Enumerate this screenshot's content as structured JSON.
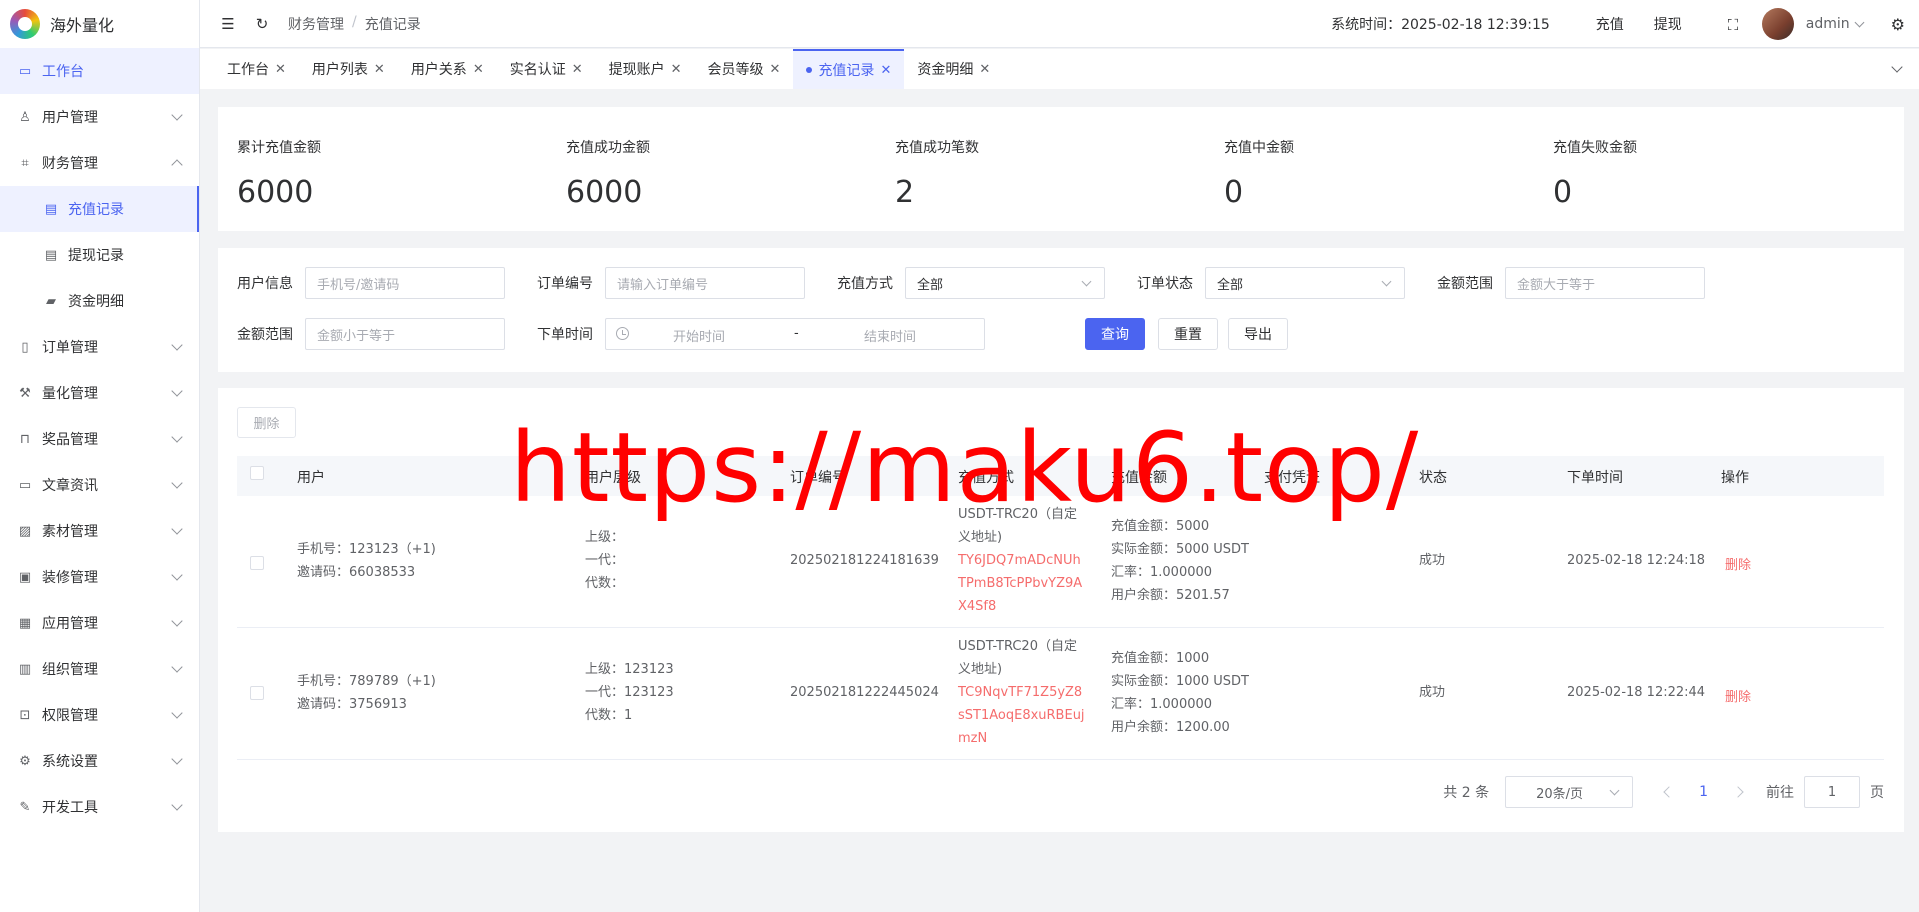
{
  "app": {
    "name": "海外量化"
  },
  "sidebar": {
    "items": [
      {
        "label": "工作台",
        "icon": "monitor-icon",
        "glyph": "▭"
      },
      {
        "label": "用户管理",
        "icon": "user-icon",
        "glyph": "♙"
      },
      {
        "label": "财务管理",
        "icon": "chart-icon",
        "glyph": "⌗"
      },
      {
        "label": "充值记录",
        "icon": "folder-icon",
        "glyph": "▤"
      },
      {
        "label": "提现记录",
        "icon": "folder-icon",
        "glyph": "▤"
      },
      {
        "label": "资金明细",
        "icon": "wallet-icon",
        "glyph": "▰"
      },
      {
        "label": "订单管理",
        "icon": "document-icon",
        "glyph": "▯"
      },
      {
        "label": "量化管理",
        "icon": "tool-icon",
        "glyph": "⚒"
      },
      {
        "label": "奖品管理",
        "icon": "bag-icon",
        "glyph": "⊓"
      },
      {
        "label": "文章资讯",
        "icon": "message-icon",
        "glyph": "▭"
      },
      {
        "label": "素材管理",
        "icon": "image-icon",
        "glyph": "▨"
      },
      {
        "label": "装修管理",
        "icon": "brush-icon",
        "glyph": "▣"
      },
      {
        "label": "应用管理",
        "icon": "app-icon",
        "glyph": "▦"
      },
      {
        "label": "组织管理",
        "icon": "building-icon",
        "glyph": "▥"
      },
      {
        "label": "权限管理",
        "icon": "lock-icon",
        "glyph": "⊡"
      },
      {
        "label": "系统设置",
        "icon": "settings-icon",
        "glyph": "⚙"
      },
      {
        "label": "开发工具",
        "icon": "pen-icon",
        "glyph": "✎"
      }
    ]
  },
  "header": {
    "breadcrumb": [
      "财务管理",
      "充值记录"
    ],
    "breadcrumb_sep": "/",
    "system_time": "系统时间：2025-02-18 12:39:15",
    "recharge": "充值",
    "withdraw": "提现",
    "user": "admin"
  },
  "tabs": [
    {
      "label": "工作台"
    },
    {
      "label": "用户列表"
    },
    {
      "label": "用户关系"
    },
    {
      "label": "实名认证"
    },
    {
      "label": "提现账户"
    },
    {
      "label": "会员等级"
    },
    {
      "label": "充值记录",
      "active": true
    },
    {
      "label": "资金明细"
    }
  ],
  "stats": [
    {
      "label": "累计充值金额",
      "value": "6000"
    },
    {
      "label": "充值成功金额",
      "value": "6000"
    },
    {
      "label": "充值成功笔数",
      "value": "2"
    },
    {
      "label": "充值中金额",
      "value": "0"
    },
    {
      "label": "充值失败金额",
      "value": "0"
    }
  ],
  "filter": {
    "user_info_label": "用户信息",
    "user_info_placeholder": "手机号/邀请码",
    "order_no_label": "订单编号",
    "order_no_placeholder": "请输入订单编号",
    "method_label": "充值方式",
    "method_value": "全部",
    "status_label": "订单状态",
    "status_value": "全部",
    "amount_range_label": "金额范围",
    "amount_min_placeholder": "金额大于等于",
    "amount_range_label2": "金额范围",
    "amount_max_placeholder": "金额小于等于",
    "time_label": "下单时间",
    "start_placeholder": "开始时间",
    "range_sep": "-",
    "end_placeholder": "结束时间",
    "query": "查询",
    "reset": "重置",
    "export": "导出"
  },
  "table": {
    "delete_button": "删除",
    "columns": [
      "用户",
      "用户层级",
      "订单编号",
      "充值方式",
      "充值金额",
      "支付凭证",
      "状态",
      "下单时间",
      "操作"
    ],
    "rows": [
      {
        "phone": "手机号：123123（+1)",
        "invite": "邀请码：66038533",
        "parent": "上级：",
        "first": "一代：",
        "gen": "代数：",
        "order_no": "202502181224181639",
        "method_1": "USDT-TRC20（自定",
        "method_2": "义地址)",
        "address_1": "TY6JDQ7mADcNUh",
        "address_2": "TPmB8TcPPbvYZ9A",
        "address_3": "X4Sf8",
        "amount": "充值金额：5000",
        "actual": "实际金额：5000 USDT",
        "rate": "汇率：1.000000",
        "balance": "用户余额：5201.57",
        "status": "成功",
        "time": "2025-02-18 12:24:18",
        "action": "删除"
      },
      {
        "phone": "手机号：789789（+1)",
        "invite": "邀请码：3756913",
        "parent": "上级：123123",
        "first": "一代：123123",
        "gen": "代数：1",
        "order_no": "202502181222445024",
        "method_1": "USDT-TRC20（自定",
        "method_2": "义地址)",
        "address_1": "TC9NqvTF71Z5yZ8",
        "address_2": "sST1AoqE8xuRBEuj",
        "address_3": "mzN",
        "amount": "充值金额：1000",
        "actual": "实际金额：1000 USDT",
        "rate": "汇率：1.000000",
        "balance": "用户余额：1200.00",
        "status": "成功",
        "time": "2025-02-18 12:22:44",
        "action": "删除"
      }
    ]
  },
  "pagination": {
    "total": "共 2 条",
    "page_size": "20条/页",
    "current": "1",
    "goto_label": "前往",
    "goto_value": "1",
    "page_suffix": "页"
  },
  "watermark": "https://maku6.top/",
  "colors": {
    "primary": "#4b64f0",
    "danger": "#f56c6c",
    "watermark": "#ff0000"
  }
}
